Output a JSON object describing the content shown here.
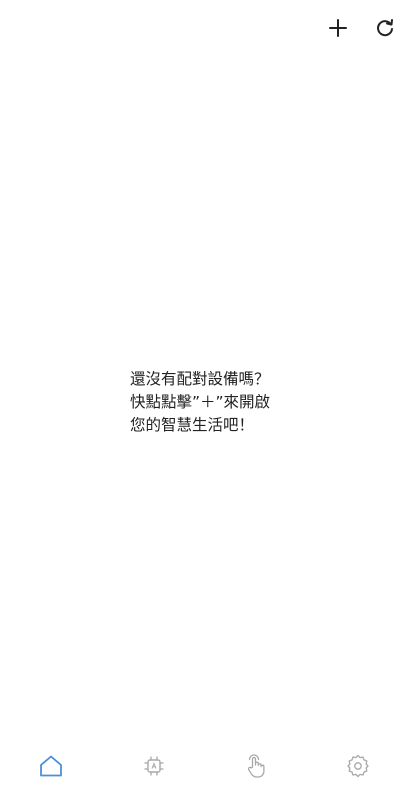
{
  "header": {
    "add_icon": "plus-icon",
    "refresh_icon": "refresh-icon"
  },
  "empty_state": {
    "line1": "還沒有配對設備嗎？",
    "line2": "快點點擊”＋”來開啟",
    "line3": "您的智慧生活吧！"
  },
  "bottom_nav": {
    "items": [
      {
        "icon": "home-icon",
        "active": true
      },
      {
        "icon": "automation-chip-icon",
        "active": false
      },
      {
        "icon": "tap-hand-icon",
        "active": false
      },
      {
        "icon": "settings-gear-icon",
        "active": false
      }
    ]
  },
  "colors": {
    "active": "#4a90d9",
    "inactive": "#a8a8a8",
    "text": "#222222",
    "icon_dark": "#222222"
  }
}
